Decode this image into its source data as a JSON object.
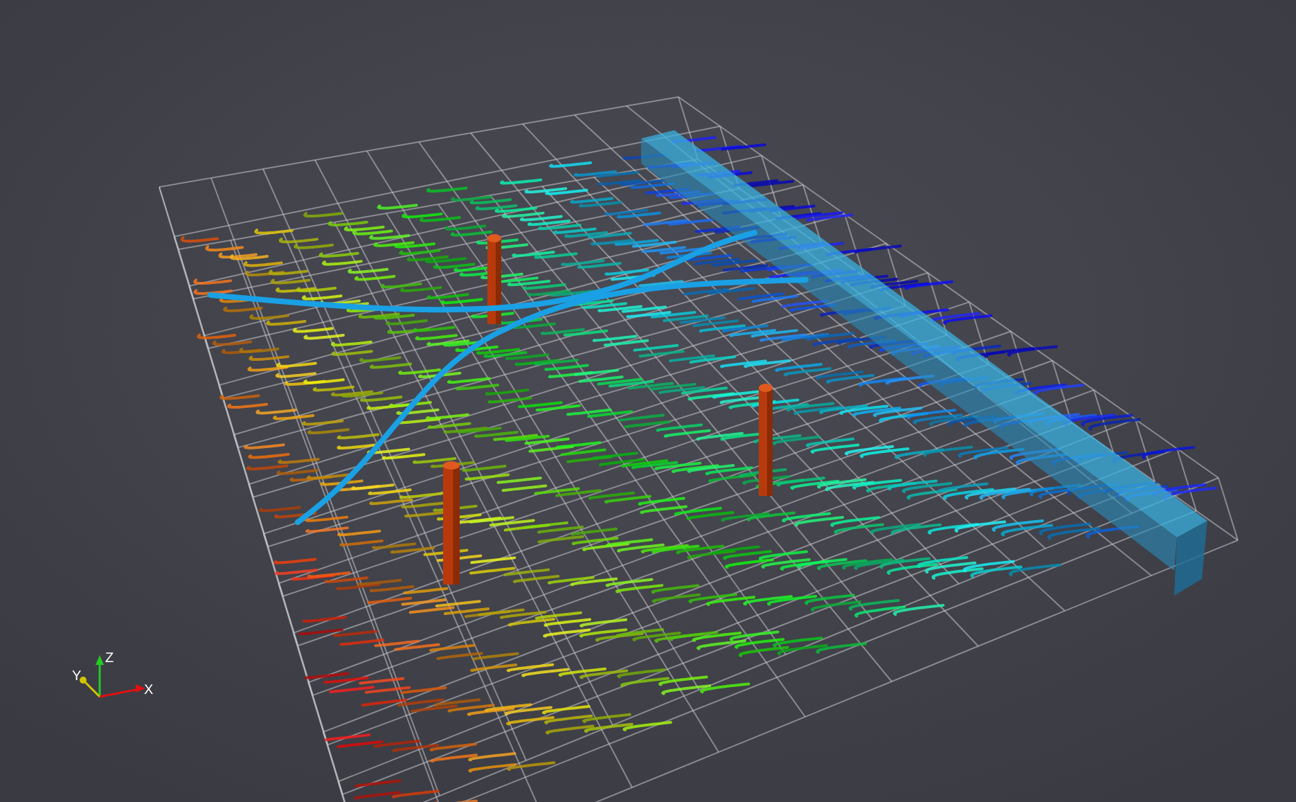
{
  "viewport": {
    "axes": [
      {
        "label": "Z",
        "color": "#22cc22"
      },
      {
        "label": "Y",
        "color": "#d4c400"
      },
      {
        "label": "X",
        "color": "#e01010"
      }
    ]
  }
}
